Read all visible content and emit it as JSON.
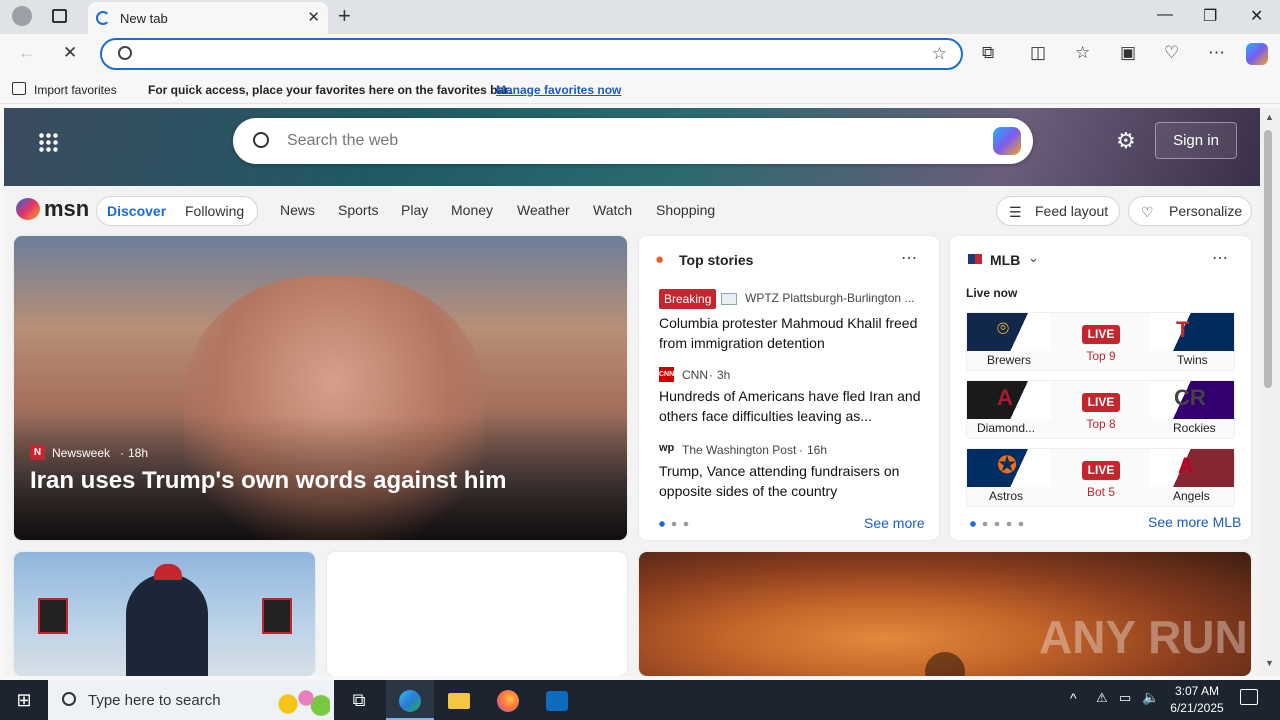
{
  "tab": {
    "title": "New tab",
    "close": "✕",
    "new": "+"
  },
  "window": {
    "minimize": "—",
    "restore": "❐",
    "close": "✕"
  },
  "omnibox": {
    "value": "",
    "placeholder": ""
  },
  "favorites": {
    "import_label": "Import favorites",
    "hint": "For quick access, place your favorites here on the favorites bar.",
    "manage_link": "Manage favorites now"
  },
  "msn": {
    "search_placeholder": "Search the web",
    "sign_in": "Sign in",
    "logo_text": "msn",
    "tabs": [
      "Discover",
      "Following"
    ],
    "nav": [
      "News",
      "Sports",
      "Play",
      "Money",
      "Weather",
      "Watch",
      "Shopping"
    ],
    "feed_layout": "Feed layout",
    "personalize": "Personalize"
  },
  "hero": {
    "source": "Newsweek",
    "age": "18h",
    "headline": "Iran uses Trump's own words against him"
  },
  "top_stories": {
    "title": "Top stories",
    "see_more": "See more",
    "items": [
      {
        "badge": "Breaking",
        "source": "WPTZ Plattsburgh-Burlington ...",
        "age": "",
        "headline": "Columbia protester Mahmoud Khalil freed from immigration detention"
      },
      {
        "badge": "",
        "source": "CNN",
        "age": "3h",
        "headline": "Hundreds of Americans have fled Iran and others face difficulties leaving as..."
      },
      {
        "badge": "",
        "source": "The Washington Post",
        "age": "16h",
        "headline": "Trump, Vance attending fundraisers on opposite sides of the country"
      }
    ]
  },
  "mlb": {
    "title": "MLB",
    "live_now": "Live now",
    "see_more": "See more MLB",
    "games": [
      {
        "away": "Brewers",
        "home": "Twins",
        "status": "LIVE",
        "inning": "Top 9",
        "away_color": "#12284b",
        "home_color": "#002b5c"
      },
      {
        "away": "Diamond...",
        "home": "Rockies",
        "status": "LIVE",
        "inning": "Top 8",
        "away_color": "#1a1a1a",
        "home_color": "#33006f"
      },
      {
        "away": "Astros",
        "home": "Angels",
        "status": "LIVE",
        "inning": "Bot 5",
        "away_color": "#002d62",
        "home_color": "#862633"
      }
    ]
  },
  "taskbar": {
    "search_placeholder": "Type here to search",
    "time": "3:07 AM",
    "date": "6/21/2025"
  },
  "watermark": "ANY RUN",
  "colors": {
    "accent": "#1a6cd4",
    "live": "#c4262e",
    "breaking": "#c4262e"
  }
}
